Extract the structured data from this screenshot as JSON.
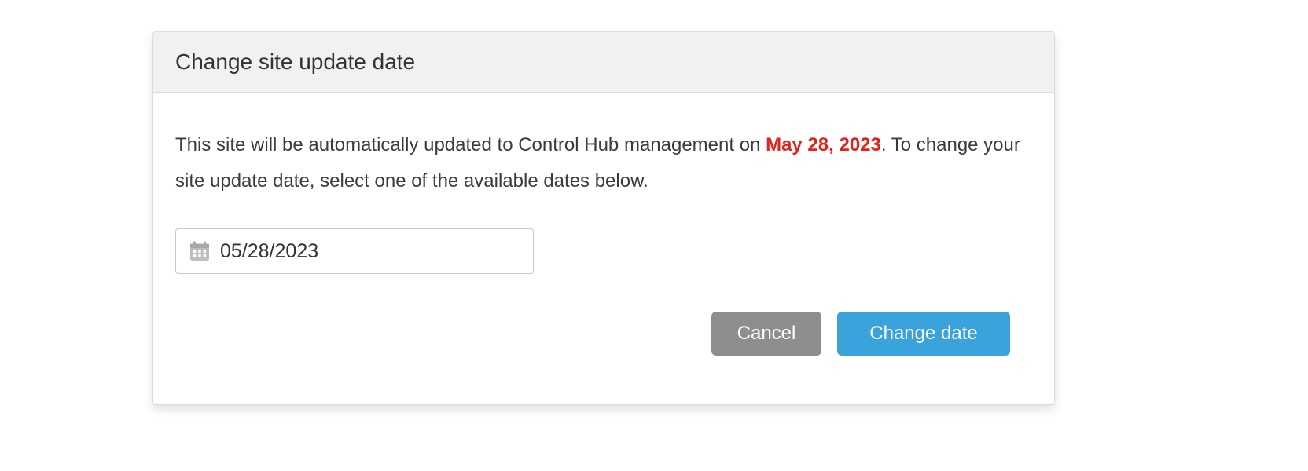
{
  "dialog": {
    "title": "Change site update date",
    "description_pre": "This site will be automatically updated to Control Hub management on ",
    "highlight_date": "May 28, 2023",
    "description_post": ". To change your site update date, select one of the available dates below.",
    "date_input_value": "05/28/2023",
    "cancel_label": "Cancel",
    "change_label": "Change date"
  }
}
